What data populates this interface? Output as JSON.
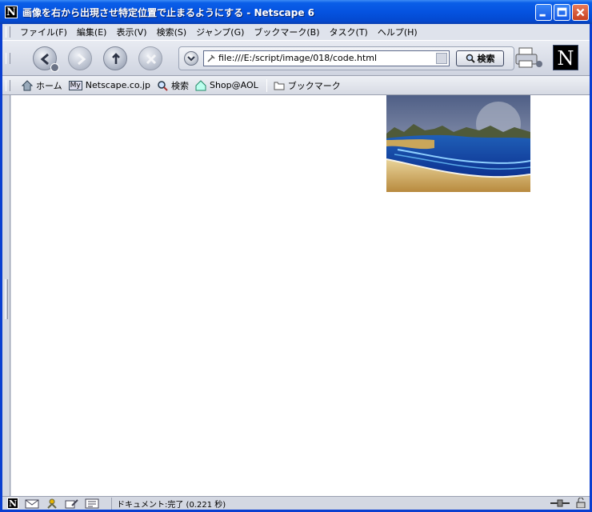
{
  "window": {
    "title": "画像を右から出現させ特定位置で止まるようにする - Netscape 6",
    "app_icon_letter": "N"
  },
  "menu": {
    "items": [
      {
        "label": "ファイル(F)"
      },
      {
        "label": "編集(E)"
      },
      {
        "label": "表示(V)"
      },
      {
        "label": "検索(S)"
      },
      {
        "label": "ジャンプ(G)"
      },
      {
        "label": "ブックマーク(B)"
      },
      {
        "label": "タスク(T)"
      },
      {
        "label": "ヘルプ(H)"
      }
    ]
  },
  "navigation": {
    "url": "file:///E:/script/image/018/code.html",
    "search_label": "検索",
    "logo_letter": "N"
  },
  "personal_toolbar": {
    "home": "ホーム",
    "my_badge": "My",
    "netscape": "Netscape.co.jp",
    "search": "検索",
    "shop": "Shop@AOL",
    "bookmarks": "ブックマーク"
  },
  "status": {
    "text": "ドキュメント:完了 (0.221 秒)"
  },
  "colors": {
    "titlebar": "#0553e0",
    "content_bg": "#ffffff"
  }
}
